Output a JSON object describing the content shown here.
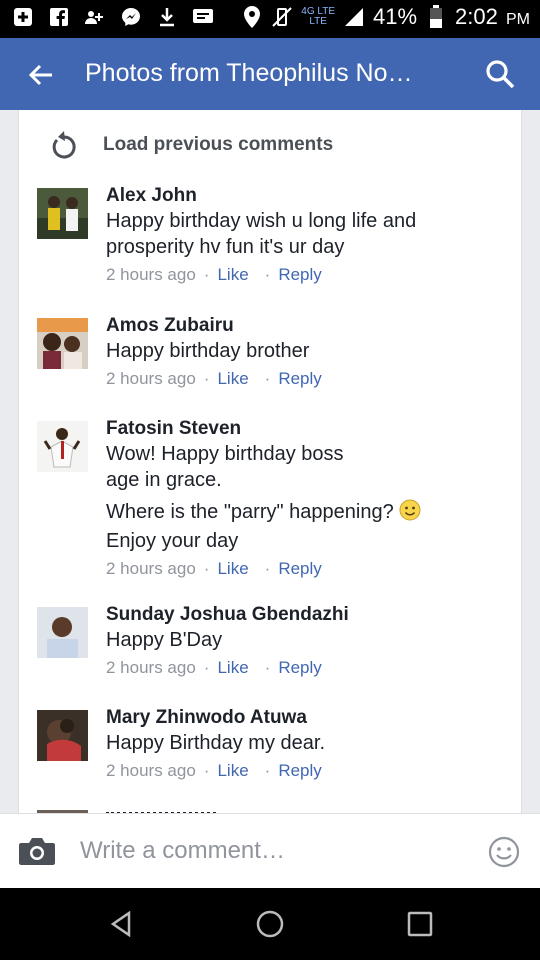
{
  "status_bar": {
    "network_top": "4G LTE",
    "network_bottom": "LTE",
    "battery": "41%",
    "time": "2:02",
    "ampm": "PM",
    "icons": [
      "add-box-icon",
      "facebook-icon",
      "people-icon",
      "messenger-icon",
      "download-icon",
      "message-icon",
      "location-icon",
      "vibrate-off-icon",
      "signal-icon",
      "battery-icon"
    ]
  },
  "app_bar": {
    "title": "Photos from Theophilus No…",
    "back_icon": "arrow-left-icon",
    "search_icon": "search-icon",
    "background": "#4267b2"
  },
  "comments_section": {
    "load_previous": "Load previous comments",
    "comments": [
      {
        "author": "Alex John",
        "text": "Happy birthday wish u long life and prosperity hv fun it's ur day",
        "time": "2 hours ago",
        "like": "Like",
        "reply": "Reply"
      },
      {
        "author": "Amos Zubairu",
        "text": "Happy birthday brother",
        "time": "2 hours ago",
        "like": "Like",
        "reply": "Reply"
      },
      {
        "author": "Fatosin Steven",
        "text": "Wow! Happy birthday boss age in grace.",
        "text2": "Where is the \"parry\" happening?",
        "text3": "Enjoy your day",
        "time": "2 hours ago",
        "like": "Like",
        "reply": "Reply"
      },
      {
        "author": "Sunday Joshua Gbendazhi",
        "text": "Happy B'Day",
        "time": "2 hours ago",
        "like": "Like",
        "reply": "Reply"
      },
      {
        "author": "Mary Zhinwodo Atuwa",
        "text": "Happy Birthday my dear.",
        "time": "2 hours ago",
        "like": "Like",
        "reply": "Reply"
      }
    ],
    "separator": "·",
    "link_color": "#4267b2",
    "meta_color": "#90949c"
  },
  "composer": {
    "placeholder": "Write a comment…",
    "camera_icon": "camera-icon",
    "emoji_icon": "smiley-icon"
  },
  "nav_bar": {
    "icons": [
      "back-triangle-icon",
      "home-circle-icon",
      "recents-square-icon"
    ]
  }
}
